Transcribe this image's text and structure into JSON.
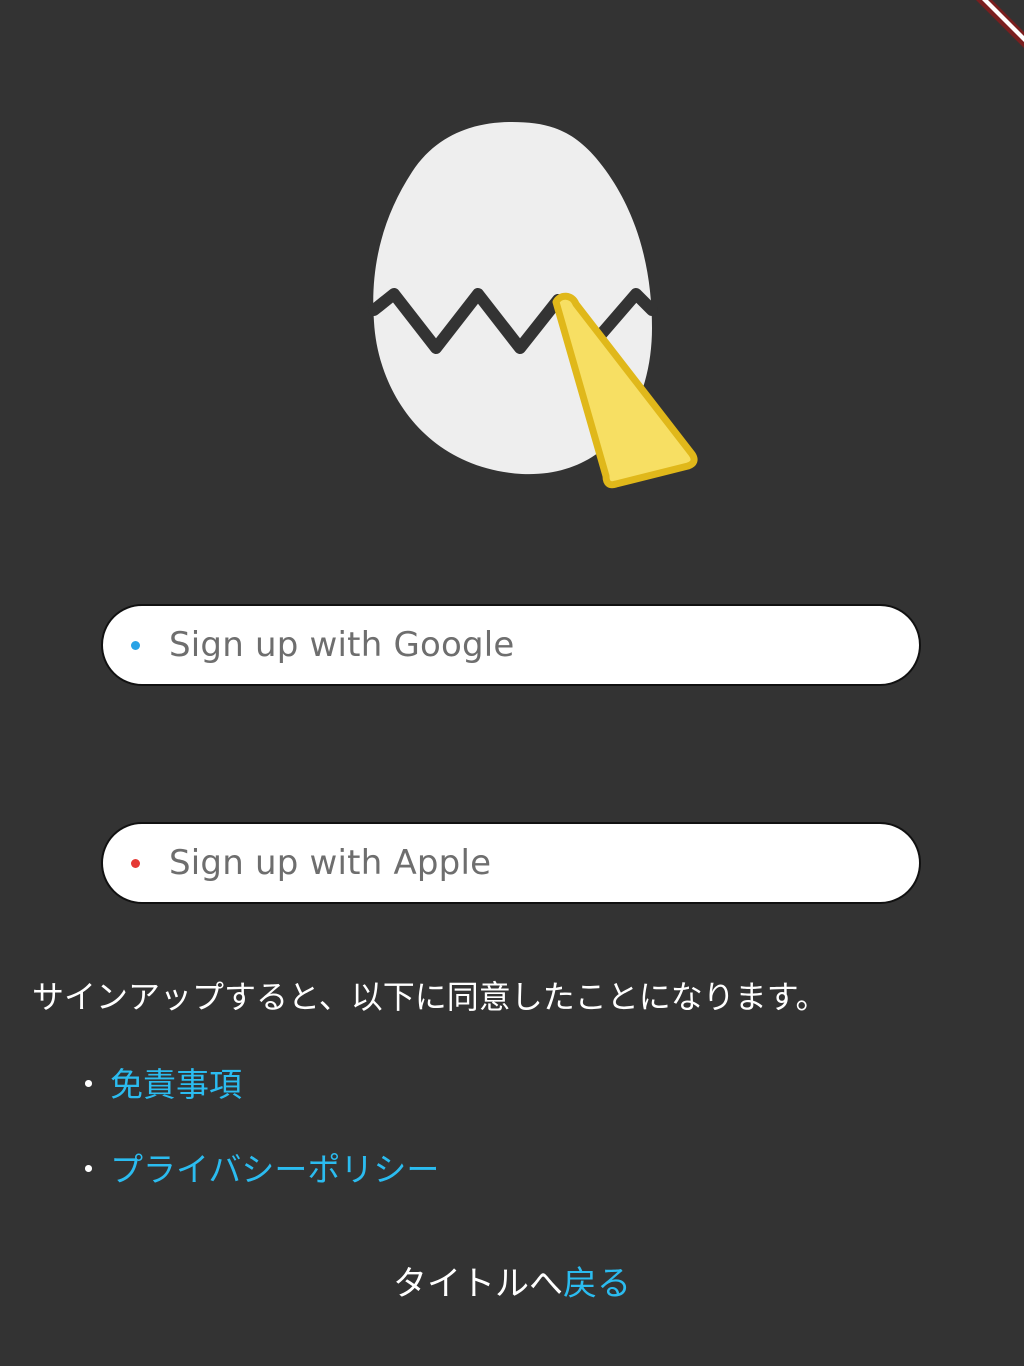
{
  "colors": {
    "background": "#333333",
    "button_background": "#ffffff",
    "button_text": "#6e6e6e",
    "link": "#2bbcf0",
    "google_dot": "#29a3e6",
    "apple_dot": "#e53935",
    "egg_shell": "#eeeeee",
    "crack_line": "#333333",
    "pen": "#f7df63"
  },
  "logo": {
    "icon": "cracked-egg-with-pen-icon"
  },
  "debug_banner": {
    "icon": "debug-banner-icon"
  },
  "buttons": {
    "google_label": "Sign up with Google",
    "google_icon": "blue-dot-icon",
    "apple_label": "Sign up with Apple",
    "apple_icon": "red-dot-icon"
  },
  "agreement": {
    "text": "サインアップすると、以下に同意したことになります。",
    "bullet": "・",
    "disclaimer_link": "免責事項",
    "privacy_link": "プライバシーポリシー"
  },
  "footer": {
    "back_prefix": "タイトルへ",
    "back_link": "戻る"
  }
}
